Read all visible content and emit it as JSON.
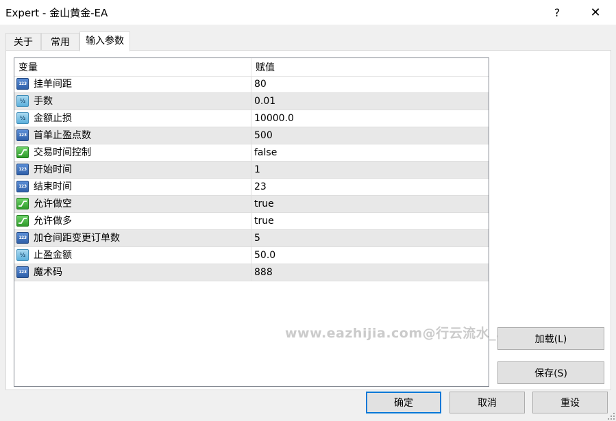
{
  "window": {
    "title": "Expert - 金山黄金-EA",
    "help_label": "?",
    "close_label": "✕"
  },
  "tabs": [
    {
      "label": "关于"
    },
    {
      "label": "常用"
    },
    {
      "label": "输入参数",
      "active": true
    }
  ],
  "grid": {
    "columns": [
      "变量",
      "赋值"
    ],
    "rows": [
      {
        "icon": "int-type-icon",
        "badge": "123",
        "name": "挂单间距",
        "value": "80"
      },
      {
        "icon": "double-type-icon",
        "badge": "½",
        "name": "手数",
        "value": "0.01"
      },
      {
        "icon": "double-type-icon",
        "badge": "½",
        "name": "金额止损",
        "value": "10000.0"
      },
      {
        "icon": "int-type-icon",
        "badge": "123",
        "name": "首单止盈点数",
        "value": "500"
      },
      {
        "icon": "bool-type-icon",
        "badge": "",
        "name": "交易时间控制",
        "value": "false"
      },
      {
        "icon": "int-type-icon",
        "badge": "123",
        "name": "开始时间",
        "value": "1"
      },
      {
        "icon": "int-type-icon",
        "badge": "123",
        "name": "结束时间",
        "value": "23"
      },
      {
        "icon": "bool-type-icon",
        "badge": "",
        "name": "允许做空",
        "value": "true"
      },
      {
        "icon": "bool-type-icon",
        "badge": "",
        "name": "允许做多",
        "value": "true"
      },
      {
        "icon": "int-type-icon",
        "badge": "123",
        "name": "加仓间距变更订单数",
        "value": "5"
      },
      {
        "icon": "double-type-icon",
        "badge": "½",
        "name": "止盈金额",
        "value": "50.0"
      },
      {
        "icon": "int-type-icon",
        "badge": "123",
        "name": "魔术码",
        "value": "888"
      }
    ]
  },
  "watermark": "www.eazhijia.com@行云流水_3971",
  "buttons": {
    "load": "加载(L)",
    "save": "保存(S)",
    "ok": "确定",
    "cancel": "取消",
    "reset": "重设"
  },
  "colors": {
    "accent": "#0078d7",
    "row_alt": "#e8e8e8",
    "int_icon": "#2f5fa8",
    "double_icon": "#5eb0dc",
    "bool_icon": "#2e9a2a"
  }
}
